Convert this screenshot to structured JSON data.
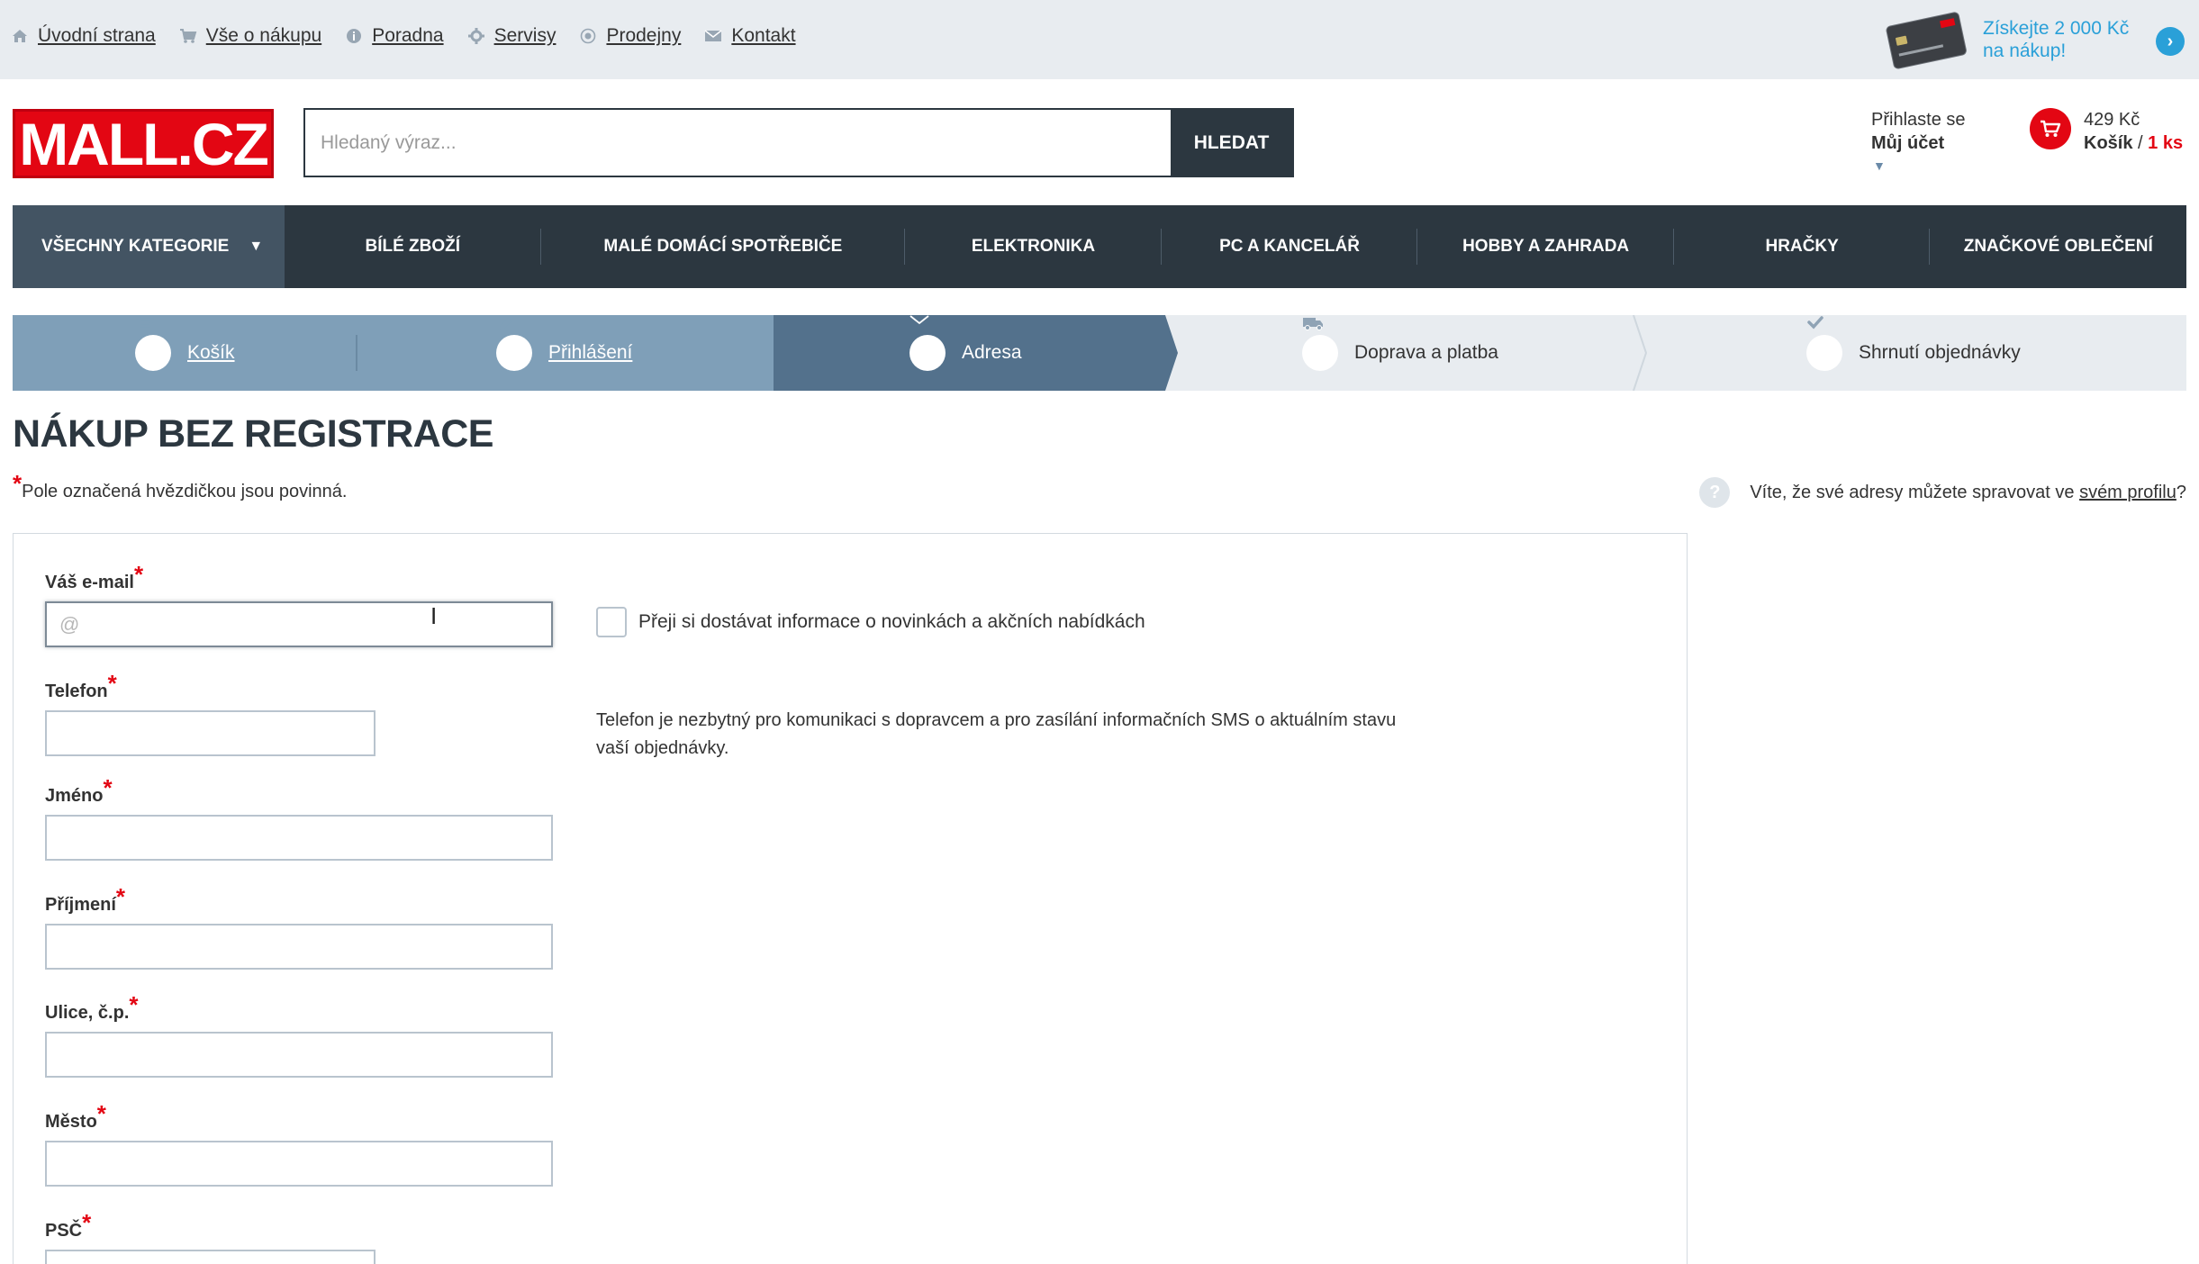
{
  "topbar": {
    "links": [
      {
        "label": "Úvodní strana",
        "icon": "home-icon"
      },
      {
        "label": "Vše o nákupu",
        "icon": "cart-icon"
      },
      {
        "label": "Poradna",
        "icon": "info-icon"
      },
      {
        "label": "Servisy",
        "icon": "gear-icon"
      },
      {
        "label": "Prodejny",
        "icon": "location-icon"
      },
      {
        "label": "Kontakt",
        "icon": "envelope-icon"
      }
    ],
    "promo": {
      "line1": "Získejte 2 000 Kč",
      "line2": "na nákup!"
    }
  },
  "header": {
    "logo": "MALL.CZ",
    "search_placeholder": "Hledaný výraz...",
    "search_button": "HLEDAT",
    "account": {
      "login": "Přihlaste se",
      "my_account": "Můj účet"
    },
    "cart": {
      "price": "429 Kč",
      "label": "Košík",
      "sep": " / ",
      "count": "1 ks"
    }
  },
  "nav": {
    "all_categories": "VŠECHNY KATEGORIE",
    "items": [
      "BÍLÉ ZBOŽÍ",
      "MALÉ DOMÁCÍ SPOTŘEBIČE",
      "ELEKTRONIKA",
      "PC A KANCELÁŘ",
      "HOBBY A ZAHRADA",
      "HRAČKY",
      "ZNAČKOVÉ OBLEČENÍ"
    ]
  },
  "steps": [
    {
      "label": "Košík",
      "state": "done",
      "icon": "cart-icon"
    },
    {
      "label": "Přihlášení",
      "state": "done",
      "icon": "pencil-icon"
    },
    {
      "label": "Adresa",
      "state": "current",
      "icon": "envelope-icon"
    },
    {
      "label": "Doprava a platba",
      "state": "todo",
      "icon": "truck-icon"
    },
    {
      "label": "Shrnutí objednávky",
      "state": "todo",
      "icon": "check-icon"
    }
  ],
  "page": {
    "title": "NÁKUP BEZ REGISTRACE",
    "required_note": "Pole označená hvězdičkou jsou povinná.",
    "tip_prefix": "Víte, že své adresy můžete spravovat ve ",
    "tip_link": "svém profilu",
    "tip_suffix": "?"
  },
  "form": {
    "email": {
      "label": "Váš e-mail",
      "placeholder": "@",
      "value": ""
    },
    "newsletter": {
      "label": "Přeji si dostávat informace o novinkách a akčních nabídkách",
      "checked": false
    },
    "phone": {
      "label": "Telefon",
      "value": ""
    },
    "phone_help": "Telefon je nezbytný pro komunikaci s dopravcem a pro zasílání informačních SMS o aktuálním stavu vaší objednávky.",
    "first_name": {
      "label": "Jméno",
      "value": ""
    },
    "last_name": {
      "label": "Příjmení",
      "value": ""
    },
    "street": {
      "label": "Ulice, č.p.",
      "value": ""
    },
    "city": {
      "label": "Město",
      "value": ""
    },
    "zip": {
      "label": "PSČ",
      "value": ""
    },
    "required_mark": "*"
  },
  "colors": {
    "brand_red": "#e30613",
    "nav_dark": "#2c3740",
    "step_done": "#7f9fb8",
    "step_current": "#53718c",
    "accent_blue": "#2aa0d8"
  }
}
